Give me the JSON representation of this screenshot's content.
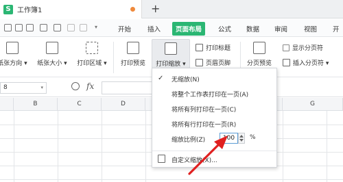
{
  "titlebar": {
    "app_icon_letter": "S",
    "doc_title": "工作簿1",
    "new_tab_symbol": "+"
  },
  "menubar": {
    "items": [
      "开始",
      "插入",
      "页面布局",
      "公式",
      "数据",
      "审阅",
      "视图",
      "开"
    ],
    "active_index": 2
  },
  "ribbon": {
    "paper_orientation": "纸张方向 ▾",
    "paper_size": "纸张大小 ▾",
    "print_area": "打印区域 ▾",
    "print_preview": "打印预览",
    "print_scale": "打印缩放 ▾",
    "print_titles": "打印标题",
    "header_footer": "页眉页脚",
    "page_break_preview": "分页预览",
    "show_page_breaks": "显示分页符",
    "insert_page_break": "插入分页符 ▾"
  },
  "formula_bar": {
    "name_box_value": "8",
    "fx_label": "fx"
  },
  "grid": {
    "columns": [
      "B",
      "C",
      "D",
      "G"
    ]
  },
  "dropdown": {
    "checkmark": "✓",
    "items": [
      "无缩放(N)",
      "将整个工作表打印在一页(A)",
      "将所有列打印在一页(C)",
      "将所有行打印在一页(R)"
    ],
    "scale_label": "缩放比例(Z)",
    "scale_value": "100",
    "scale_unit": "%",
    "custom": "自定义缩放(X)..."
  },
  "colors": {
    "accent": "#2bb673",
    "arrow": "#e02020",
    "title_dot": "#ef8a3c"
  }
}
